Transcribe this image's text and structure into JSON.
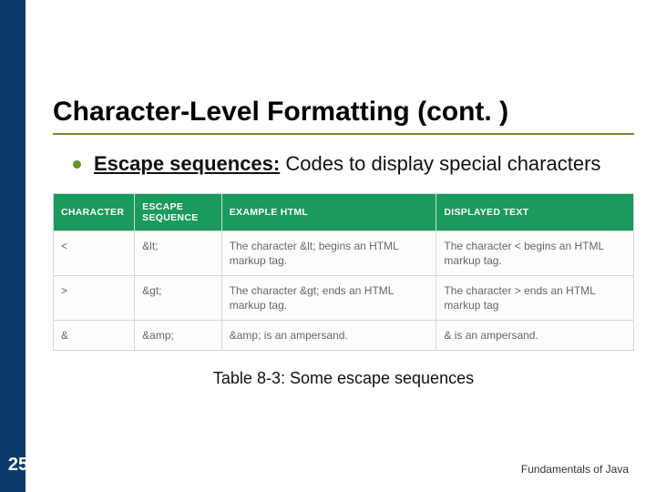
{
  "slide": {
    "title": "Character-Level Formatting (cont. )",
    "bullet": {
      "lead": "Escape sequences:",
      "rest": " Codes to display special characters"
    },
    "table": {
      "headers": [
        "CHARACTER",
        "ESCAPE SEQUENCE",
        "EXAMPLE HTML",
        "DISPLAYED TEXT"
      ],
      "rows": [
        {
          "char": "<",
          "seq": "&lt;",
          "example": "The character &lt; begins an HTML markup tag.",
          "display": "The character < begins an HTML markup tag."
        },
        {
          "char": ">",
          "seq": "&gt;",
          "example": "The character &gt; ends an HTML markup tag.",
          "display": "The character > ends an HTML markup tag"
        },
        {
          "char": "&",
          "seq": "&amp;",
          "example": "&amp; is an ampersand.",
          "display": "& is an ampersand."
        }
      ]
    },
    "caption": "Table 8-3: Some escape sequences",
    "page": "25",
    "footer": "Fundamentals of Java"
  }
}
